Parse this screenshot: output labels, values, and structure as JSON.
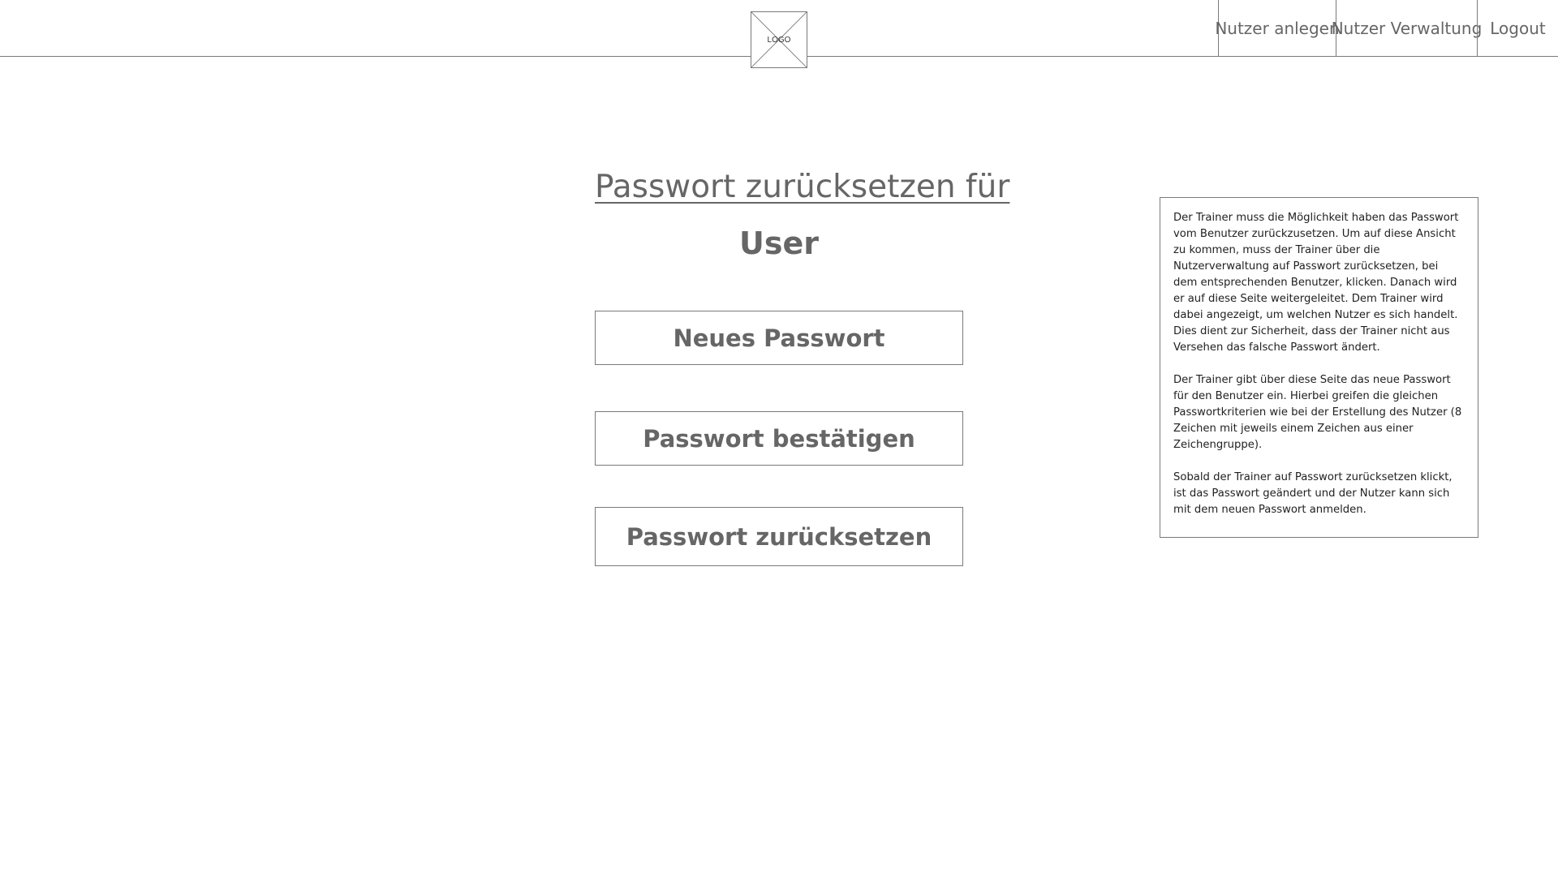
{
  "header": {
    "logo_text": "LOGO",
    "nav": {
      "create_user": "Nutzer anlegen",
      "manage_users": "Nutzer Verwaltung",
      "logout": "Logout"
    }
  },
  "main": {
    "title": "Passwort zurücksetzen für",
    "username": "User",
    "new_password_label": "Neues Passwort",
    "confirm_password_label": "Passwort bestätigen",
    "reset_button_label": "Passwort zurücksetzen"
  },
  "note": {
    "paragraphs": [
      "Der Trainer muss die Möglichkeit haben das Passwort vom Benutzer zurückzusetzen. Um auf diese Ansicht zu kommen, muss der Trainer über die Nutzerverwaltung auf Passwort zurücksetzen, bei dem entsprechenden Benutzer, klicken. Danach wird er auf diese Seite weitergeleitet. Dem Trainer wird dabei angezeigt, um welchen Nutzer es sich handelt. Dies dient zur Sicherheit, dass der Trainer nicht aus Versehen das falsche Passwort ändert.",
      "Der Trainer gibt über diese Seite das neue Passwort für den Benutzer ein. Hierbei greifen die gleichen Passwortkriterien wie bei der Erstellung des Nutzer (8 Zeichen mit jeweils einem Zeichen aus einer Zeichengruppe).",
      "Sobald der Trainer auf Passwort zurücksetzen klickt, ist das Passwort geändert und der Nutzer kann sich mit dem neuen Passwort anmelden."
    ]
  }
}
